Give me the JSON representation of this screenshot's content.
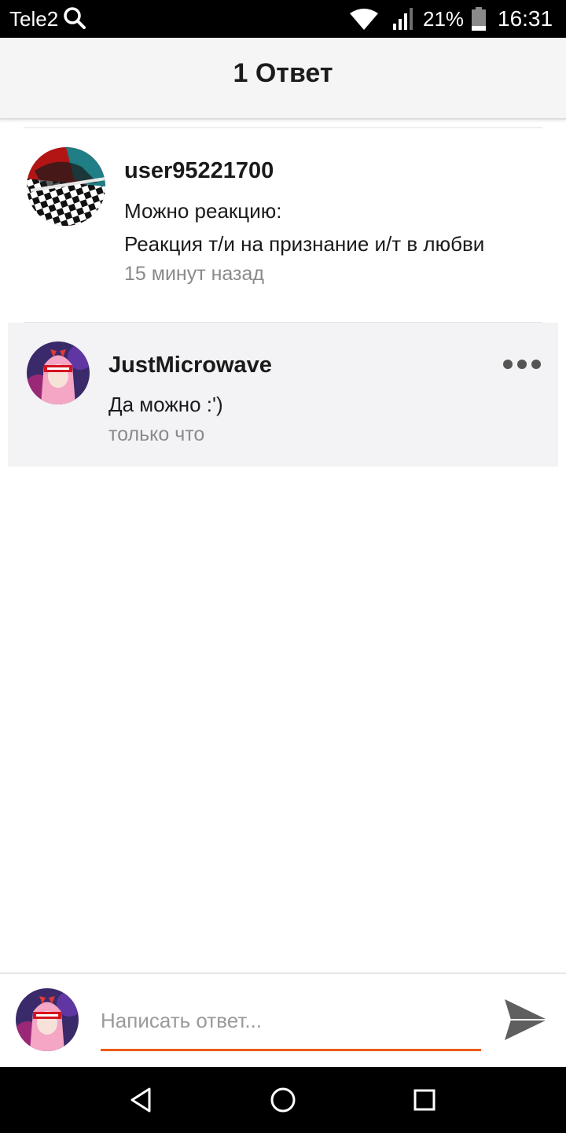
{
  "status_bar": {
    "carrier": "Tele2",
    "battery_percent": "21%",
    "time": "16:31",
    "icons": [
      "search-icon",
      "wifi-icon",
      "signal-icon",
      "battery-icon"
    ]
  },
  "header": {
    "title": "1 Ответ"
  },
  "original_post": {
    "username": "user95221700",
    "line1": "Можно реакцию:",
    "line2": "Реакция т/и на признание и/т в любви",
    "time": "15 минут назад"
  },
  "reply": {
    "username": "JustMicrowave",
    "text": "Да можно :')",
    "time": "только что"
  },
  "composer": {
    "placeholder": "Написать ответ...",
    "value": ""
  },
  "nav_bar": {
    "icons": [
      "back-icon",
      "home-icon",
      "recents-icon"
    ]
  },
  "colors": {
    "accent": "#ee5a16",
    "header_bg": "#f5f5f5",
    "reply_bg": "#f3f3f6",
    "muted_text": "#8a8a8a"
  }
}
